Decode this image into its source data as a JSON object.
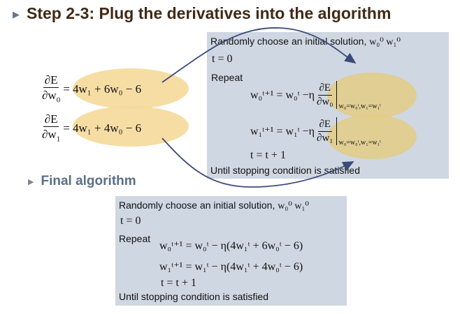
{
  "slide": {
    "title": "Step 2-3: Plug the derivatives into the algorithm",
    "subtitle": "Final algorithm"
  },
  "derivatives": {
    "dw0": {
      "numerator": "∂E",
      "denominator": "∂w",
      "denominator_sub": "0",
      "rhs": "= 4w₁ + 6w₀ − 6"
    },
    "dw1": {
      "numerator": "∂E",
      "denominator": "∂w",
      "denominator_sub": "1",
      "rhs": "= 4w₁ + 4w₀ − 6"
    }
  },
  "algorithm_template": {
    "init": "Randomly choose an initial solution,",
    "init_vars": "w₀⁰ w₁⁰",
    "t_init": "t = 0",
    "repeat": "Repeat",
    "update0_lhs": "w₀ᵗ⁺¹ = w₀ᵗ −η",
    "update1_lhs": "w₁ᵗ⁺¹ = w₁ᵗ −η",
    "grad_num": "∂E",
    "grad0_den": "∂w₀",
    "grad1_den": "∂w₁",
    "eval_sub": "w₀=w₀ᵗ,w₁=w₁ᵗ",
    "t_increment": "t = t + 1",
    "until": "Until stopping condition is satisfied"
  },
  "final_algorithm": {
    "init": "Randomly choose an initial solution,",
    "init_vars": "w₀⁰ w₁⁰",
    "t_init": "t = 0",
    "repeat": "Repeat",
    "update0": "w₀ᵗ⁺¹ = w₀ᵗ − η(4w₁ᵗ + 6w₀ᵗ − 6)",
    "update1": "w₁ᵗ⁺¹ = w₁ᵗ − η(4w₁ᵗ + 4w₀ᵗ − 6)",
    "t_increment": "t = t + 1",
    "until": "Until stopping condition is satisfied"
  },
  "colors": {
    "title": "#3f2a16",
    "subtitle": "#5a6f88",
    "panel": "#cfd7e2",
    "highlight": "#f5d99a",
    "arrow": "#3b4a78"
  }
}
